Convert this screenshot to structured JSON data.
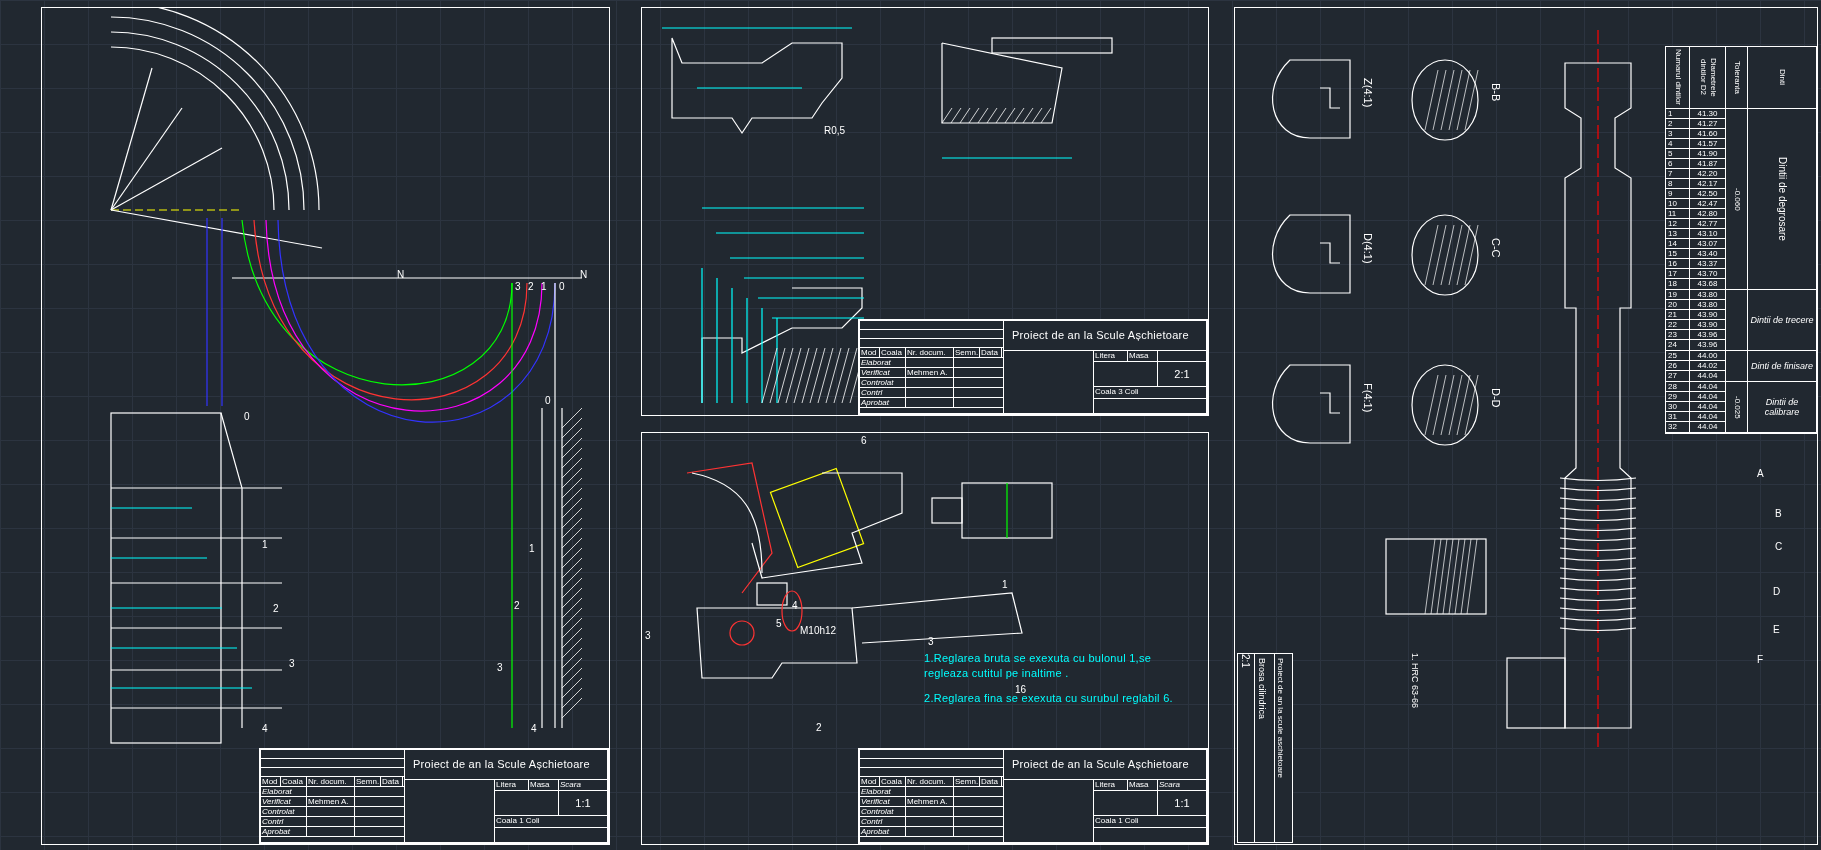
{
  "sheet_1": {
    "labels": [
      "N",
      "N",
      "3",
      "2",
      "1",
      "0",
      "0",
      "0",
      "1",
      "2",
      "3",
      "4",
      "1",
      "2",
      "3",
      "4"
    ],
    "title_block": {
      "title": "Proiect de an la Scule Așchietoare",
      "header_cells": [
        "Mod",
        "Coala",
        "Nr. docum.",
        "Semn.",
        "Data"
      ],
      "roles": [
        {
          "role": "Elaborat"
        },
        {
          "role": "Verificat",
          "name": "Mehmen A."
        },
        {
          "role": "Controlat"
        },
        {
          "role": "Contrl"
        },
        {
          "role": "Aprobat"
        }
      ],
      "litera": "Litera",
      "masa": "Masa",
      "scara": "Scara",
      "scale": "1:1",
      "coala": "Coala 1 Coli"
    }
  },
  "sheet_2_top": {
    "labels": [
      "R0,5"
    ],
    "title_block": {
      "title": "Proiect de an la Scule Așchietoare",
      "header_cells": [
        "Mod",
        "Coala",
        "Nr. docum.",
        "Semn.",
        "Data"
      ],
      "roles": [
        {
          "role": "Elaborat"
        },
        {
          "role": "Verificat",
          "name": "Mehmen A."
        },
        {
          "role": "Controlat"
        },
        {
          "role": "Contrl"
        },
        {
          "role": "Aprobat"
        }
      ],
      "litera": "Litera",
      "masa": "Masa",
      "scale": "2:1",
      "coala": "Coala 3 Coli"
    }
  },
  "sheet_2_bottom": {
    "labels": [
      "6",
      "1",
      "M10h12",
      "3",
      "5",
      "4",
      "3",
      "2",
      "16"
    ],
    "notes": [
      "1.Reglarea bruta se exexuta cu bulonul 1,se regleaza cutitul pe inaltime .",
      "2.Reglarea fina se exexuta cu surubul reglabil 6."
    ],
    "title_block": {
      "title": "Proiect de an la Scule Așchietoare",
      "header_cells": [
        "Mod",
        "Coala",
        "Nr. docum.",
        "Semn.",
        "Data"
      ],
      "roles": [
        {
          "role": "Elaborat"
        },
        {
          "role": "Verificat",
          "name": "Mehmen A."
        },
        {
          "role": "Controlat"
        },
        {
          "role": "Contrl"
        },
        {
          "role": "Aprobat"
        }
      ],
      "litera": "Litera",
      "masa": "Masa",
      "scara": "Scara",
      "scale": "1:1",
      "coala": "Coala 1 Coli"
    }
  },
  "sheet_3": {
    "section_labels": [
      "Z(4:1)",
      "B-B",
      "D(4:1)",
      "C-C",
      "F(4:1)",
      "D-D"
    ],
    "letters": [
      "A",
      "B",
      "C",
      "D",
      "E",
      "F"
    ],
    "notes": [
      "1. HRC 63-66"
    ],
    "title_block": {
      "title": "Proiect de an la scule aschietoare",
      "name": "Brosa cilindrica",
      "scale": "2:1"
    },
    "table": {
      "headers": [
        "Numarul dintilor",
        "Diametrele dintilor D2",
        "Toleranta",
        "Dinti"
      ],
      "groups": [
        {
          "tolerance": "-0.060",
          "label": "Dintii de degrosare",
          "kind": "vertical",
          "rows": [
            {
              "n": "1",
              "d": "41.30"
            },
            {
              "n": "2",
              "d": "41.27"
            },
            {
              "n": "3",
              "d": "41.60"
            },
            {
              "n": "4",
              "d": "41.57"
            },
            {
              "n": "5",
              "d": "41.90"
            },
            {
              "n": "6",
              "d": "41.87"
            },
            {
              "n": "7",
              "d": "42.20"
            },
            {
              "n": "8",
              "d": "42.17"
            },
            {
              "n": "9",
              "d": "42.50"
            },
            {
              "n": "10",
              "d": "42.47"
            },
            {
              "n": "11",
              "d": "42.80"
            },
            {
              "n": "12",
              "d": "42.77"
            },
            {
              "n": "13",
              "d": "43.10"
            },
            {
              "n": "14",
              "d": "43.07"
            },
            {
              "n": "15",
              "d": "43.40"
            },
            {
              "n": "16",
              "d": "43.37"
            },
            {
              "n": "17",
              "d": "43.70"
            },
            {
              "n": "18",
              "d": "43.68"
            }
          ]
        },
        {
          "label": "Dintii de trecere",
          "kind": "italic",
          "rows": [
            {
              "n": "19",
              "d": "43.80"
            },
            {
              "n": "20",
              "d": "43.80"
            },
            {
              "n": "21",
              "d": "43.90"
            },
            {
              "n": "22",
              "d": "43.90"
            },
            {
              "n": "23",
              "d": "43.96"
            },
            {
              "n": "24",
              "d": "43.96"
            }
          ]
        },
        {
          "label": "Dinti de finisare",
          "kind": "italic",
          "rows": [
            {
              "n": "25",
              "d": "44.00"
            },
            {
              "n": "26",
              "d": "44.02"
            },
            {
              "n": "27",
              "d": "44.04"
            }
          ]
        },
        {
          "tolerance": "-0.025",
          "label": "Dintii de calibrare",
          "kind": "italic",
          "rows": [
            {
              "n": "28",
              "d": "44.04"
            },
            {
              "n": "29",
              "d": "44.04"
            },
            {
              "n": "30",
              "d": "44.04"
            },
            {
              "n": "31",
              "d": "44.04"
            },
            {
              "n": "32",
              "d": "44.04"
            }
          ]
        }
      ]
    }
  }
}
